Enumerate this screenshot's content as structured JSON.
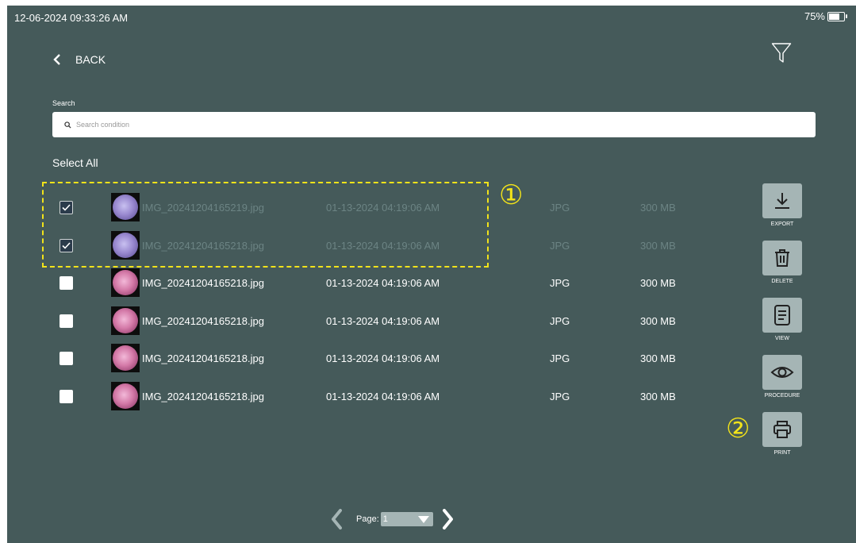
{
  "status_bar": {
    "datetime": "12-06-2024 09:33:26 AM",
    "battery": "75%",
    "battery_level": 0.75
  },
  "nav": {
    "back_label": "BACK"
  },
  "search": {
    "label": "Search",
    "placeholder": "Search condition",
    "value": ""
  },
  "list": {
    "select_all_label": "Select All",
    "rows": [
      {
        "selected": true,
        "filename": "IMG_20241204165219.jpg",
        "date": "01-13-2024 04:19:06 AM",
        "type": "JPG",
        "size": "300 MB"
      },
      {
        "selected": true,
        "filename": "IMG_20241204165218.jpg",
        "date": "01-13-2024 04:19:06 AM",
        "type": "JPG",
        "size": "300 MB"
      },
      {
        "selected": false,
        "filename": "IMG_20241204165218.jpg",
        "date": "01-13-2024 04:19:06 AM",
        "type": "JPG",
        "size": "300 MB"
      },
      {
        "selected": false,
        "filename": "IMG_20241204165218.jpg",
        "date": "01-13-2024 04:19:06 AM",
        "type": "JPG",
        "size": "300 MB"
      },
      {
        "selected": false,
        "filename": "IMG_20241204165218.jpg",
        "date": "01-13-2024 04:19:06 AM",
        "type": "JPG",
        "size": "300 MB"
      },
      {
        "selected": false,
        "filename": "IMG_20241204165218.jpg",
        "date": "01-13-2024 04:19:06 AM",
        "type": "JPG",
        "size": "300 MB"
      }
    ]
  },
  "actions": [
    {
      "label": "EXPORT",
      "icon": "download-icon"
    },
    {
      "label": "DELETE",
      "icon": "trash-icon"
    },
    {
      "label": "VIEW",
      "icon": "document-icon"
    },
    {
      "label": "PROCEDURE",
      "icon": "eye-icon"
    },
    {
      "label": "PRINT",
      "icon": "printer-icon"
    }
  ],
  "annotations": {
    "callout_1": "①",
    "callout_2": "②"
  },
  "pagination": {
    "page_label": "Page:",
    "current_page": "1"
  },
  "colors": {
    "background": "#455a5a",
    "button": "#a5b5b5",
    "highlight": "#f2e31a",
    "checkbox_checked": "#2b3b4b"
  }
}
